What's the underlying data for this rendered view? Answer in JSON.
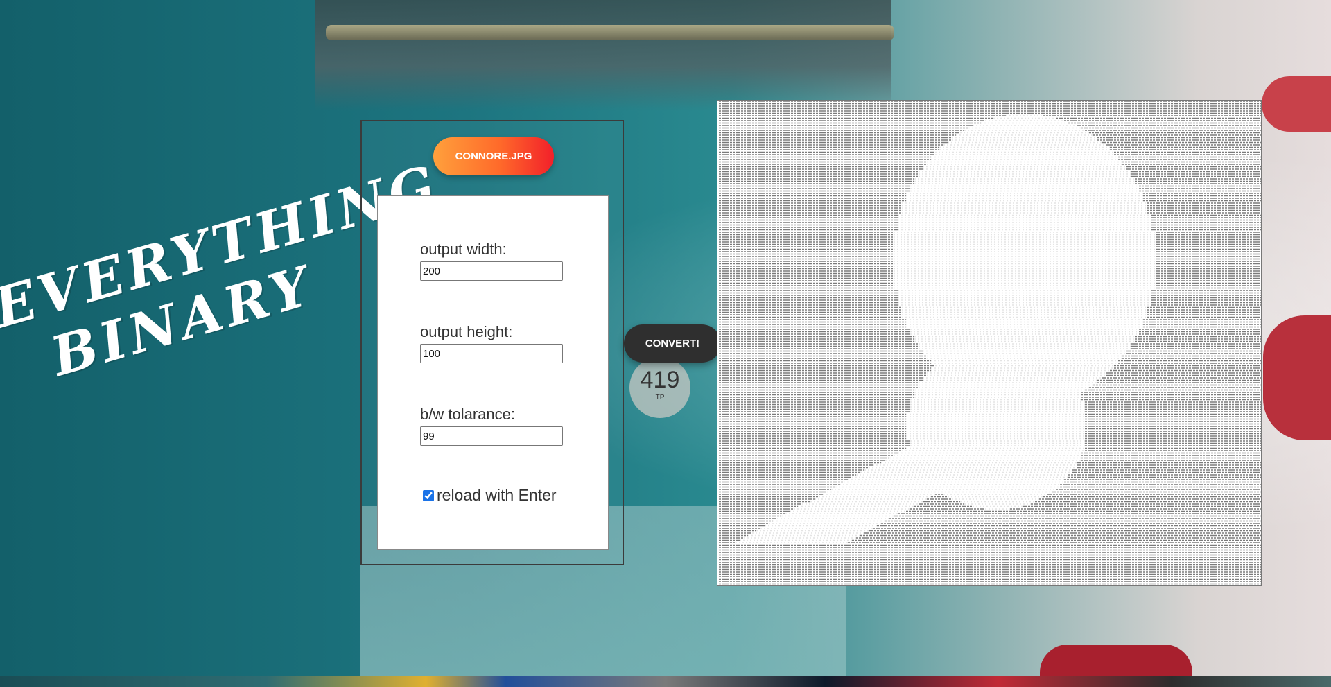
{
  "background": {
    "sign_number": "419",
    "sign_sub": "TP"
  },
  "title": {
    "line1": "EVERYTHING",
    "line2": "BINARY"
  },
  "file_button": {
    "label": "CONNORE.JPG"
  },
  "settings": {
    "output_width_label": "output width:",
    "output_width_value": "200",
    "output_height_label": "output height:",
    "output_height_value": "100",
    "tolerance_label": "b/w tolarance:",
    "tolerance_value": "99",
    "reload_checked": true,
    "reload_label": "reload with Enter"
  },
  "convert_button": {
    "label": "CONVERT!"
  },
  "colors": {
    "file_button_start": "#ffa03c",
    "file_button_end": "#f2202a",
    "convert_button": "#2f2f2f",
    "checkbox_accent": "#1a73e8"
  }
}
